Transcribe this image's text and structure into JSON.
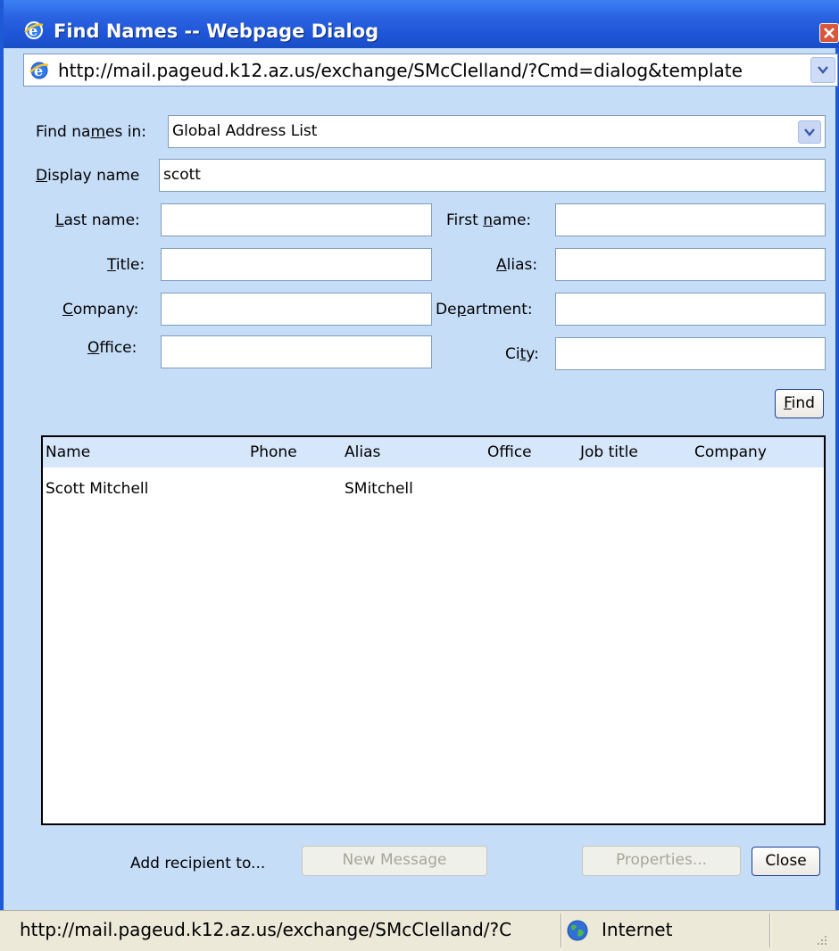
{
  "window": {
    "title": "Find Names -- Webpage Dialog",
    "address": "http://mail.pageud.k12.az.us/exchange/SMcClelland/?Cmd=dialog&template"
  },
  "form": {
    "find_names_in_label": {
      "pre": "Find na",
      "ul": "m",
      "post": "es in:"
    },
    "find_names_in_value": "Global Address List",
    "display_name_label": {
      "pre": "",
      "ul": "D",
      "post": "isplay name"
    },
    "display_name_value": "scott",
    "last_name_label": {
      "pre": "",
      "ul": "L",
      "post": "ast name:"
    },
    "first_name_label": {
      "pre": "First ",
      "ul": "n",
      "post": "ame:"
    },
    "title_label": {
      "pre": "",
      "ul": "T",
      "post": "itle:"
    },
    "alias_label": {
      "pre": "",
      "ul": "A",
      "post": "lias:"
    },
    "company_label": {
      "pre": "",
      "ul": "C",
      "post": "ompany:"
    },
    "department_label": {
      "pre": "De",
      "ul": "p",
      "post": "artment:"
    },
    "office_label": {
      "pre": "",
      "ul": "O",
      "post": "ffice:"
    },
    "city_label": {
      "pre": "Ci",
      "ul": "t",
      "post": "y:"
    },
    "last_name_value": "",
    "first_name_value": "",
    "title_value": "",
    "alias_value": "",
    "company_value": "",
    "department_value": "",
    "office_value": "",
    "city_value": "",
    "find_button": {
      "pre": "",
      "ul": "F",
      "post": "ind"
    }
  },
  "results": {
    "columns": [
      "Name",
      "Phone",
      "Alias",
      "Office",
      "Job title",
      "Company"
    ],
    "rows": [
      {
        "name": "Scott Mitchell",
        "phone": "",
        "alias": "SMitchell",
        "office": "",
        "job_title": "",
        "company": ""
      }
    ]
  },
  "footer": {
    "add_recipient_label": "Add recipient to...",
    "new_message": "New Message",
    "properties": "Properties...",
    "close": "Close"
  },
  "statusbar": {
    "url": "http://mail.pageud.k12.az.us/exchange/SMcClelland/?C",
    "zone": "Internet"
  },
  "colors": {
    "titlebar": "#2a63e0",
    "dialog_bg": "#c6ddf8",
    "header_row": "#d6e6fb"
  },
  "icons": [
    "ie-icon",
    "close-icon",
    "chevron-down-icon",
    "globe-icon",
    "resize-grip-icon"
  ]
}
